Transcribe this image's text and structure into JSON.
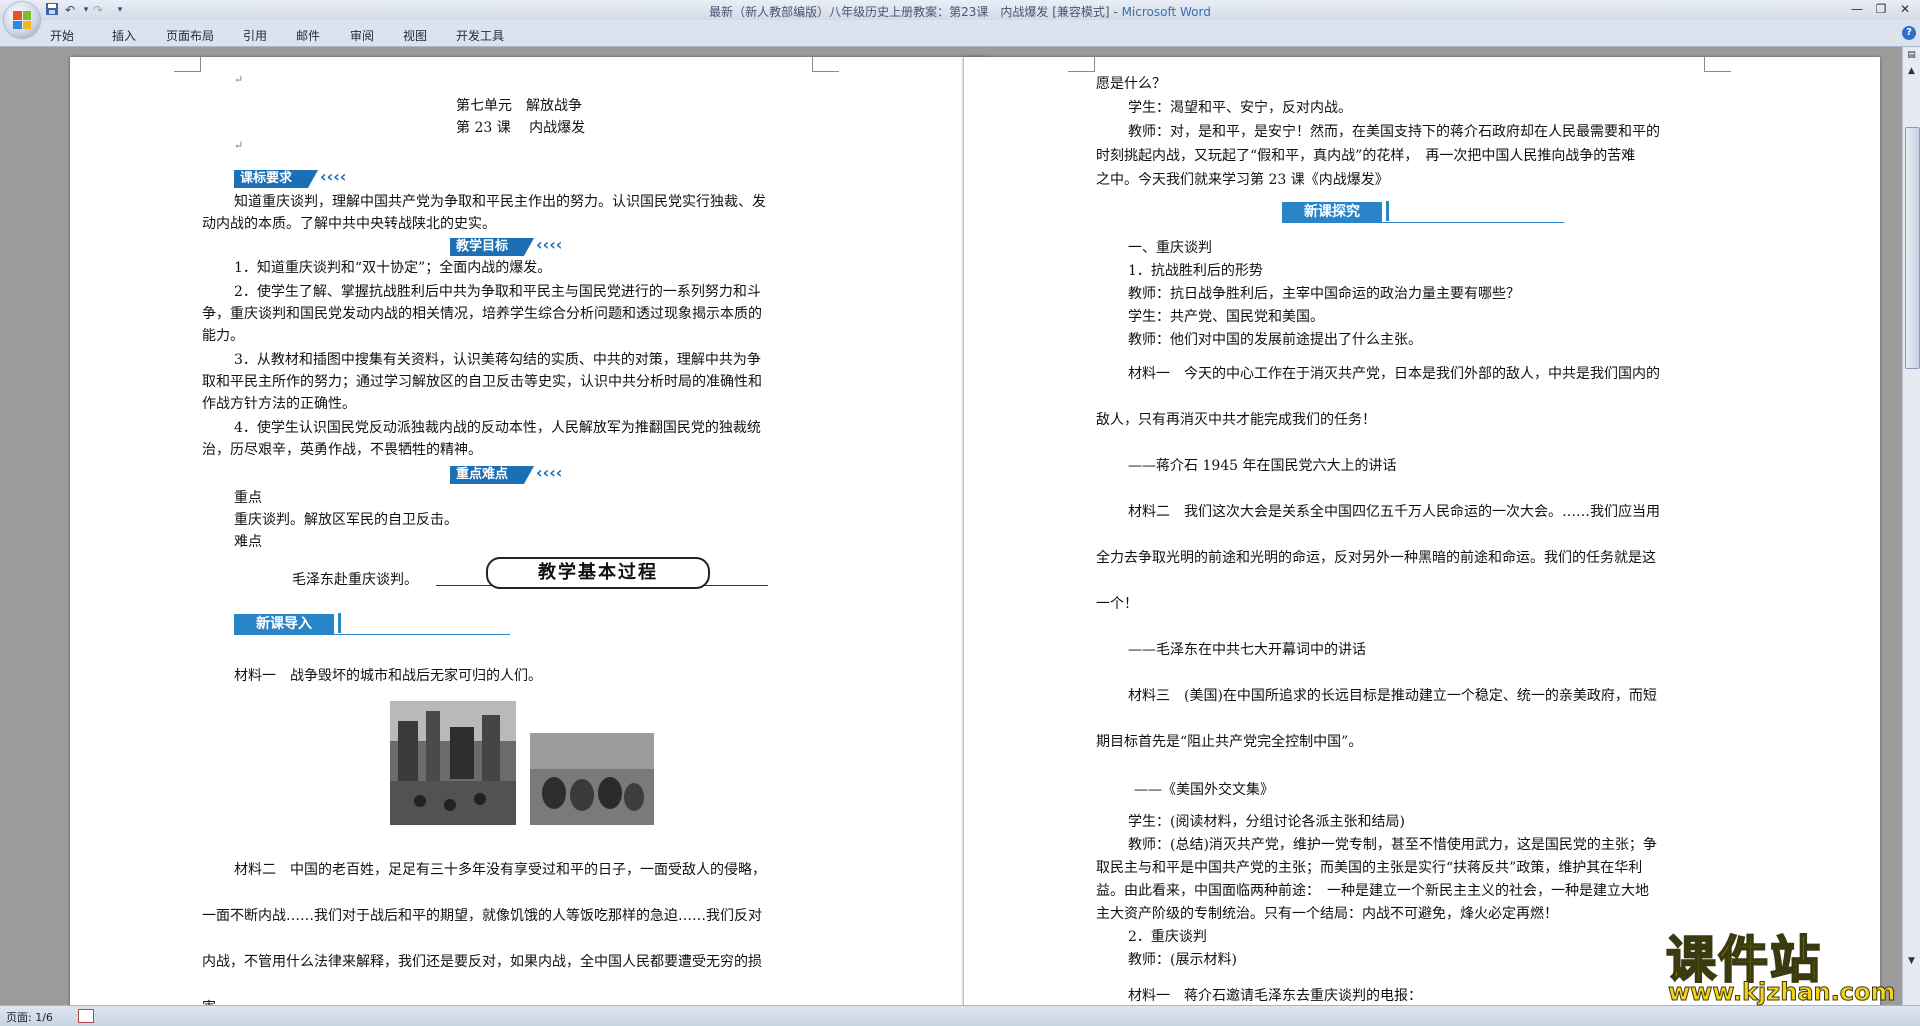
{
  "window": {
    "title": "最新（新人教部编版）八年级历史上册教案：第23课　内战爆发 [兼容模式] - ",
    "app_name": "Microsoft Word"
  },
  "quick_access": [
    "save-icon",
    "undo-icon",
    "redo-icon",
    "customize-icon"
  ],
  "ribbon_tabs": [
    "开始",
    "插入",
    "页面布局",
    "引用",
    "邮件",
    "审阅",
    "视图",
    "开发工具"
  ],
  "status": {
    "page": "页面: 1/6"
  },
  "left_page": {
    "unit": "第七单元　解放战争",
    "lesson": "第 23 课　 内战爆发",
    "banner_requirements": "课标要求",
    "req_line1": "知道重庆谈判，理解中国共产党为争取和平民主作出的努力。认识国民党实行独裁、发",
    "req_line2": "动内战的本质。了解中共中央转战陕北的史实。",
    "banner_goals": "教学目标",
    "goal1": "1．知道重庆谈判和“双十协定”；全面内战的爆发。",
    "goal2_l1": "2．使学生了解、掌握抗战胜利后中共为争取和平民主与国民党进行的一系列努力和斗",
    "goal2_l2": "争，重庆谈判和国民党发动内战的相关情况，培养学生综合分析问题和透过现象揭示本质的",
    "goal2_l3": "能力。",
    "goal3_l1": "3．从教材和插图中搜集有关资料，认识美蒋勾结的实质、中共的对策，理解中共为争",
    "goal3_l2": "取和平民主所作的努力；通过学习解放区的自卫反击等史实，认识中共分析时局的准确性和",
    "goal3_l3": "作战方针方法的正确性。",
    "goal4_l1": "4．使学生认识国民党反动派独裁内战的反动本性，人民解放军为推翻国民党的独裁统",
    "goal4_l2": "治，历尽艰辛，英勇作战，不畏牺牲的精神。",
    "banner_key": "重点难点",
    "key_label": "重点",
    "key_text": "重庆谈判。解放区军民的自卫反击。",
    "difficult_label": "难点",
    "difficult_text": "毛泽东赴重庆谈判。",
    "process_banner": "教学基本过程",
    "intro_head": "新课导入",
    "material1": "材料一　战争毁坏的城市和战后无家可归的人们。",
    "material2_l1": "材料二　中国的老百姓，足足有三十多年没有享受过和平的日子，一面受敌人的侵略，",
    "material2_l2": "一面不断内战……我们对于战后和平的期望，就像饥饿的人等饭吃那样的急迫……我们反对",
    "material2_l3": "内战，不管用什么法律来解释，我们还是要反对，如果内战，全中国人民都要遭受无穷的损",
    "material2_l4": "害……"
  },
  "right_page": {
    "l1": "愿是什么？",
    "l2": "学生：渴望和平、安宁，反对内战。",
    "l3": "教师：对，是和平，是安宁！然而，在美国支持下的蒋介石政府却在人民最需要和平的",
    "l4": "时刻挑起内战，又玩起了“假和平，真内战”的花样，　再一次把中国人民推向战争的苦难",
    "l5": "之中。今天我们就来学习第 23 课《内战爆发》",
    "explore_head": "新课探究",
    "s1": "一、重庆谈判",
    "s2": "1．抗战胜利后的形势",
    "s3": "教师：抗日战争胜利后，主宰中国命运的政治力量主要有哪些？",
    "s4": "学生：共产党、国民党和美国。",
    "s5": "教师：他们对中国的发展前途提出了什么主张。",
    "m1_l1": "材料一　今天的中心工作在于消灭共产党，日本是我们外部的敌人，中共是我们国内的",
    "m1_l2": "敌人，只有再消灭中共才能完成我们的任务！",
    "m1_src": "——蒋介石 1945 年在国民党六大上的讲话",
    "m2_l1": "材料二　我们这次大会是关系全中国四亿五千万人民命运的一次大会。……我们应当用",
    "m2_l2": "全力去争取光明的前途和光明的命运，反对另外一种黑暗的前途和命运。我们的任务就是这",
    "m2_l3": "一个！",
    "m2_src": "——毛泽东在中共七大开幕词中的讲话",
    "m3_l1": "材料三　(美国)在中国所追求的长远目标是推动建立一个稳定、统一的亲美政府，而短",
    "m3_l2": "期目标首先是“阻止共产党完全控制中国”。",
    "m3_src": "——《美国外交文集》",
    "t1": "学生：(阅读材料，分组讨论各派主张和结局)",
    "t2": "教师：(总结)消灭共产党，维护一党专制，甚至不惜使用武力，这是国民党的主张；争",
    "t3": "取民主与和平是中国共产党的主张；而美国的主张是实行“扶蒋反共”政策，维护其在华利",
    "t4": "益。由此看来，中国面临两种前途：　一种是建立一个新民主主义的社会，一种是建立大地",
    "t5": "主大资产阶级的专制统治。只有一个结局：内战不可避免，烽火必定再燃！",
    "t6": "2．重庆谈判",
    "t7": "教师：(展示材料)",
    "t8": "材料一　蒋介石邀请毛泽东去重庆谈判的电报："
  },
  "watermark": {
    "title": "课件站",
    "url": "www.kjzhan.com"
  },
  "colors": {
    "banner_blue": "#1c6fb5",
    "watermark_yellow": "#f7d21a"
  }
}
